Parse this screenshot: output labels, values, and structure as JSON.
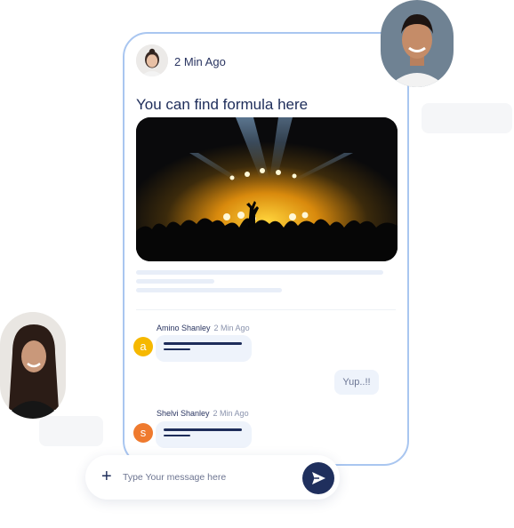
{
  "post": {
    "time": "2 Min Ago",
    "title": "You can find formula here"
  },
  "comments": [
    {
      "initial": "a",
      "name": "Amino Shanley",
      "time": "2 Min Ago",
      "color": "#f6b800"
    },
    {
      "initial": "s",
      "name": "Shelvi Shanley",
      "time": "2 Min Ago",
      "color": "#ef7a2e"
    }
  ],
  "reply": {
    "text": "Yup..!!"
  },
  "composer": {
    "plus_icon": "+",
    "placeholder": "Type Your message here",
    "send_icon": "send-icon"
  },
  "colors": {
    "card_border": "#a9c6f0",
    "accent_dark": "#1f2f5d"
  }
}
